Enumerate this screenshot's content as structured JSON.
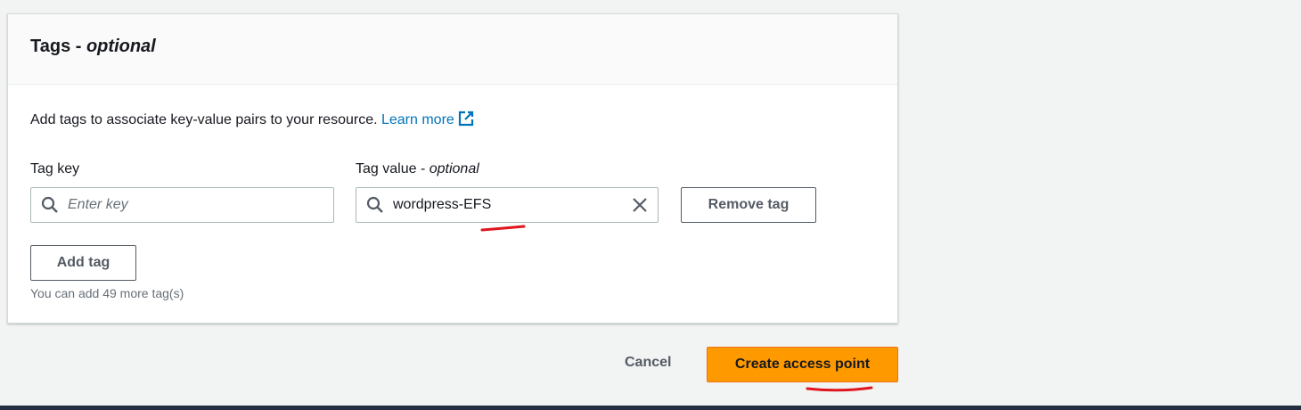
{
  "panel": {
    "title": "Tags - ",
    "title_suffix": "optional",
    "description": "Add tags to associate key-value pairs to your resource.",
    "learn_more": "Learn more"
  },
  "tag_key": {
    "label": "Tag key",
    "placeholder": "Enter key",
    "value": ""
  },
  "tag_value": {
    "label": "Tag value - ",
    "label_suffix": "optional",
    "value": "wordpress-EFS"
  },
  "buttons": {
    "remove_tag": "Remove tag",
    "add_tag": "Add tag",
    "cancel": "Cancel",
    "create": "Create access point"
  },
  "hint": "You can add 49 more tag(s)",
  "colors": {
    "link": "#0073bb",
    "primary": "#ff9900",
    "annotation": "#e0161e",
    "footer": "#232f3e"
  }
}
